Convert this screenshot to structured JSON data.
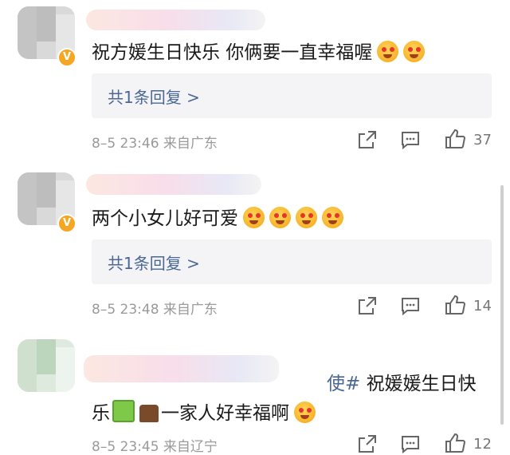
{
  "comments": [
    {
      "text": "祝方媛生日快乐 你俩要一直幸福喔",
      "reply_label": "共1条回复 >",
      "meta": "8–5 23:46 来自广东",
      "likes": "37"
    },
    {
      "text": "两个小女儿好可爱",
      "reply_label": "共1条回复 >",
      "meta": "8–5 23:48 来自广东",
      "likes": "14"
    },
    {
      "line1_tag": "使#",
      "line1_text": "祝媛媛生日快",
      "line2_a": "乐",
      "line2_b": "一家人好幸福啊",
      "meta": "8–5 23:45 来自辽宁",
      "likes": "12"
    }
  ],
  "badge_text": "V",
  "colors": {
    "link": "#4a6796",
    "meta": "#9a9a9a",
    "reply_bg": "#f4f4f6",
    "badge": "#f5a623"
  }
}
